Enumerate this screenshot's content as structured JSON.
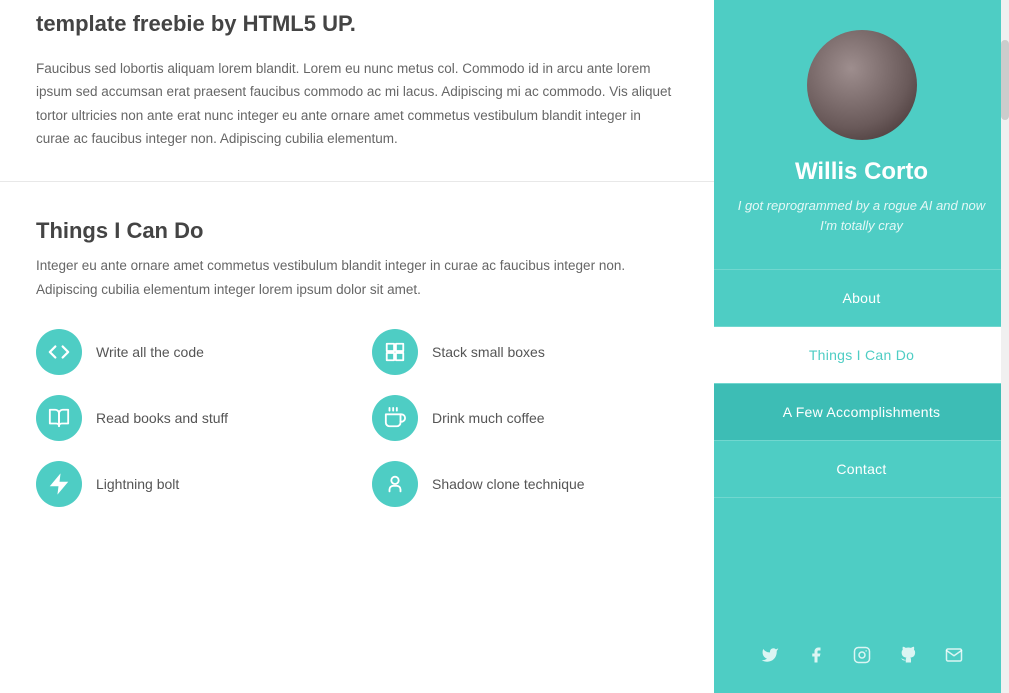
{
  "intro": {
    "title": "template freebie by HTML5 UP.",
    "body": "Faucibus sed lobortis aliquam lorem blandit. Lorem eu nunc metus col. Commodo id in arcu ante lorem ipsum sed accumsan erat praesent faucibus commodo ac mi lacus. Adipiscing mi ac commodo. Vis aliquet tortor ultricies non ante erat nunc integer eu ante ornare amet commetus vestibulum blandit integer in curae ac faucibus integer non. Adipiscing cubilia elementum."
  },
  "skills": {
    "section_title": "Things I Can Do",
    "description": "Integer eu ante ornare amet commetus vestibulum blandit integer in curae ac faucibus integer non. Adipiscing cubilia elementum integer lorem ipsum dolor sit amet.",
    "items": [
      {
        "label": "Write all the code",
        "icon": "code"
      },
      {
        "label": "Stack small boxes",
        "icon": "boxes"
      },
      {
        "label": "Read books and stuff",
        "icon": "book"
      },
      {
        "label": "Drink much coffee",
        "icon": "coffee"
      },
      {
        "label": "Lightning bolt",
        "icon": "bolt"
      },
      {
        "label": "Shadow clone technique",
        "icon": "clone"
      }
    ]
  },
  "sidebar": {
    "user_name": "Willis Corto",
    "tagline": "I got reprogrammed by a rogue AI and now I'm totally cray",
    "nav": [
      {
        "label": "About",
        "active": false,
        "things_style": false
      },
      {
        "label": "Things I Can Do",
        "active": false,
        "things_style": true
      },
      {
        "label": "A Few Accomplishments",
        "active": true,
        "things_style": false
      },
      {
        "label": "Contact",
        "active": false,
        "things_style": false
      }
    ],
    "social_icons": [
      "twitter",
      "facebook",
      "instagram",
      "github",
      "email"
    ]
  }
}
